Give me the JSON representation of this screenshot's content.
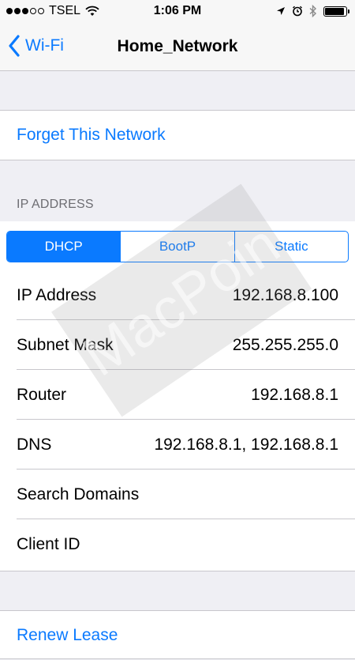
{
  "status_bar": {
    "carrier": "TSEL",
    "time": "1:06 PM"
  },
  "nav": {
    "back_label": "Wi-Fi",
    "title": "Home_Network"
  },
  "forget_label": "Forget This Network",
  "ip_section": {
    "header": "IP ADDRESS",
    "segments": [
      "DHCP",
      "BootP",
      "Static"
    ],
    "selected_segment": "DHCP",
    "rows": [
      {
        "label": "IP Address",
        "value": "192.168.8.100"
      },
      {
        "label": "Subnet Mask",
        "value": "255.255.255.0"
      },
      {
        "label": "Router",
        "value": "192.168.8.1"
      },
      {
        "label": "DNS",
        "value": "192.168.8.1, 192.168.8.1"
      },
      {
        "label": "Search Domains",
        "value": ""
      },
      {
        "label": "Client ID",
        "value": ""
      }
    ]
  },
  "renew_label": "Renew Lease",
  "watermark": "MacPoin",
  "colors": {
    "accent": "#0a7aff",
    "background": "#efeff4"
  }
}
